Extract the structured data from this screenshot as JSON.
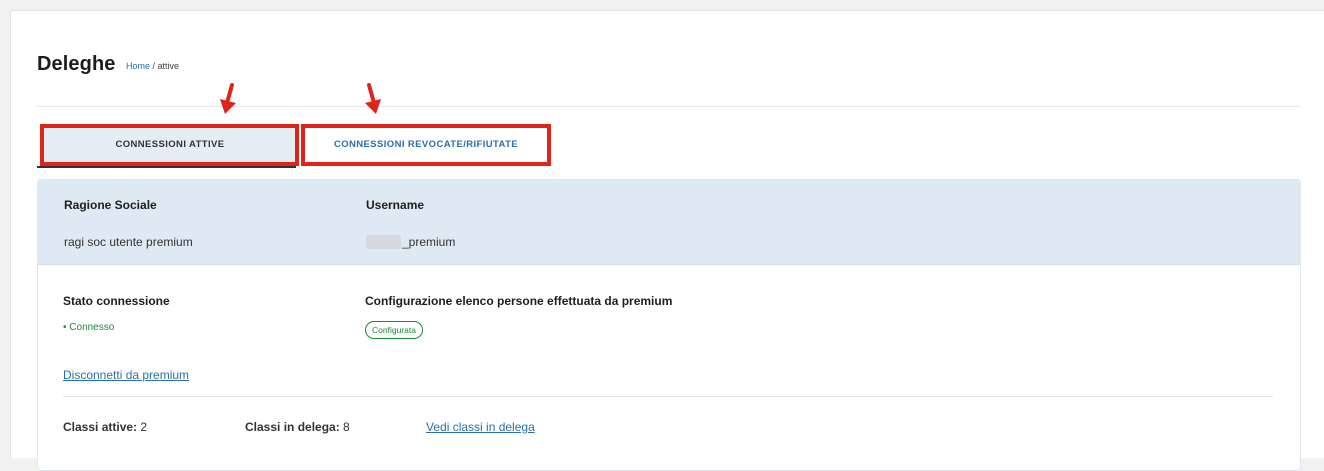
{
  "header": {
    "title": "Deleghe",
    "breadcrumb_home": "Home",
    "breadcrumb_sep": " / ",
    "breadcrumb_current": "attive"
  },
  "tabs": [
    {
      "label": "CONNESSIONI ATTIVE",
      "active": true
    },
    {
      "label": "CONNESSIONI REVOCATE/RIFIUTATE",
      "active": false
    }
  ],
  "card": {
    "ragione_label": "Ragione Sociale",
    "ragione_value": "ragi soc utente premium",
    "username_label": "Username",
    "username_value": "_premium",
    "stato_label": "Stato connessione",
    "stato_value": "• Connesso",
    "config_label": "Configurazione elenco persone effettuata da premium",
    "config_badge": "Configurata",
    "disconnect_link": "Disconnetti da premium",
    "classi_attive_label": "Classi attive:",
    "classi_attive_value": "2",
    "classi_delega_label": "Classi in delega:",
    "classi_delega_value": "8",
    "vedi_classi_link": "Vedi classi in delega"
  },
  "colors": {
    "accent_link": "#2a6fb0",
    "highlight": "#e2231a",
    "status_green": "#1b8a3a",
    "card_header_bg": "#dfe9f3"
  }
}
